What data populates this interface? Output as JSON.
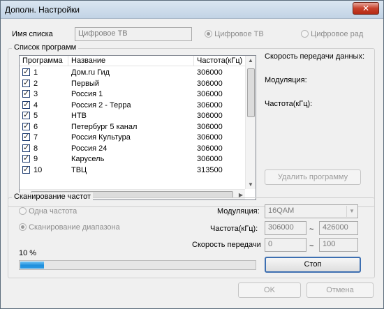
{
  "window": {
    "title": "Дополн. Настройки",
    "close_label": "✕"
  },
  "list_name": {
    "label": "Имя списка",
    "value": "Цифровое ТВ",
    "radio_tv": "Цифровое ТВ",
    "radio_radio": "Цифровое рад"
  },
  "programs": {
    "group_title": "Список программ",
    "columns": [
      "Программа",
      "Название",
      "Частота(кГц)"
    ],
    "rows": [
      {
        "num": "1",
        "name": "Дом.ru Гид",
        "freq": "306000"
      },
      {
        "num": "2",
        "name": "Первый",
        "freq": "306000"
      },
      {
        "num": "3",
        "name": "Россия 1",
        "freq": "306000"
      },
      {
        "num": "4",
        "name": "Россия 2 - Терра",
        "freq": "306000"
      },
      {
        "num": "5",
        "name": "НТВ",
        "freq": "306000"
      },
      {
        "num": "6",
        "name": "Петербург 5 канал",
        "freq": "306000"
      },
      {
        "num": "7",
        "name": "Россия Культура",
        "freq": "306000"
      },
      {
        "num": "8",
        "name": "Россия 24",
        "freq": "306000"
      },
      {
        "num": "9",
        "name": "Карусель",
        "freq": "306000"
      },
      {
        "num": "10",
        "name": "ТВЦ",
        "freq": "313500"
      }
    ],
    "info_speed": "Скорость передачи данных:",
    "info_modulation": "Модуляция:",
    "info_freq": "Частота(кГц):",
    "delete_button": "Удалить программу"
  },
  "scan": {
    "group_title": "Сканирование частот",
    "radio_single": "Одна частота",
    "radio_range": "Сканирование диапазона",
    "modulation_label": "Модуляция:",
    "modulation_value": "16QAM",
    "freq_label": "Частота(кГц):",
    "freq_from": "306000",
    "freq_to": "426000",
    "speed_label": "Скорость передачи",
    "speed_from": "0",
    "speed_to": "100",
    "tilde": "~",
    "progress_text": "10 %",
    "progress_value": 0.1,
    "stop_button": "Стоп"
  },
  "footer": {
    "ok": "OK",
    "cancel": "Отмена"
  }
}
